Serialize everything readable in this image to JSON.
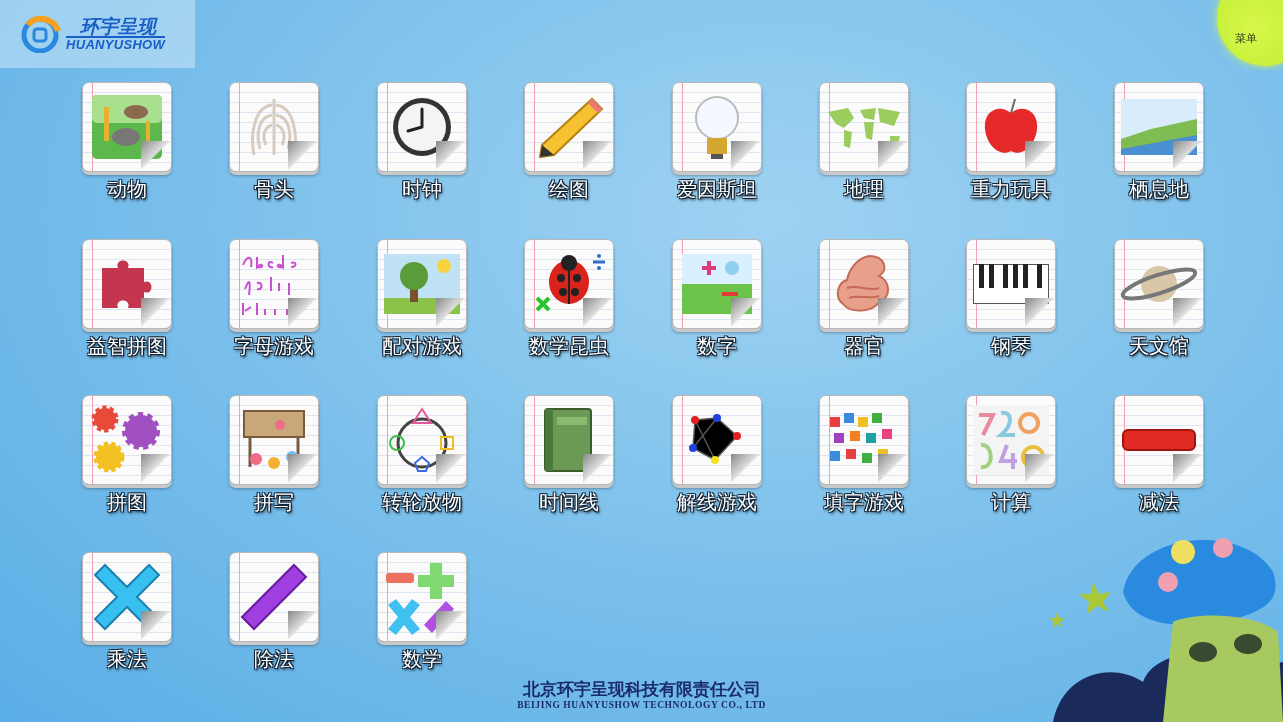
{
  "logo": {
    "title": "环宇呈现",
    "subtitle": "HUANYUSHOW"
  },
  "menu": {
    "label": "菜单"
  },
  "apps": [
    {
      "label": "动物",
      "kind": "animals"
    },
    {
      "label": "骨头",
      "kind": "ribcage"
    },
    {
      "label": "时钟",
      "kind": "clock"
    },
    {
      "label": "绘图",
      "kind": "pencil"
    },
    {
      "label": "爱因斯坦",
      "kind": "bulb"
    },
    {
      "label": "地理",
      "kind": "map"
    },
    {
      "label": "重力玩具",
      "kind": "apple"
    },
    {
      "label": "栖息地",
      "kind": "landscape"
    },
    {
      "label": "益智拼图",
      "kind": "puzzle"
    },
    {
      "label": "字母游戏",
      "kind": "letters"
    },
    {
      "label": "配对游戏",
      "kind": "tree"
    },
    {
      "label": "数学昆虫",
      "kind": "ladybug"
    },
    {
      "label": "数字",
      "kind": "numbers"
    },
    {
      "label": "器官",
      "kind": "organ"
    },
    {
      "label": "钢琴",
      "kind": "piano"
    },
    {
      "label": "天文馆",
      "kind": "planet"
    },
    {
      "label": "拼图",
      "kind": "gears"
    },
    {
      "label": "拼写",
      "kind": "flowers"
    },
    {
      "label": "转轮放物",
      "kind": "shapes"
    },
    {
      "label": "时间线",
      "kind": "book"
    },
    {
      "label": "解线游戏",
      "kind": "graph"
    },
    {
      "label": "填字游戏",
      "kind": "tiles"
    },
    {
      "label": "计算",
      "kind": "digits"
    },
    {
      "label": "减法",
      "kind": "minus"
    },
    {
      "label": "乘法",
      "kind": "times"
    },
    {
      "label": "除法",
      "kind": "divide"
    },
    {
      "label": "数学",
      "kind": "math"
    }
  ],
  "footer": {
    "company": "北京环宇呈现科技有限责任公司",
    "company_en": "BEIJING HUANYUSHOW TECHNOLOGY CO., LTD"
  }
}
